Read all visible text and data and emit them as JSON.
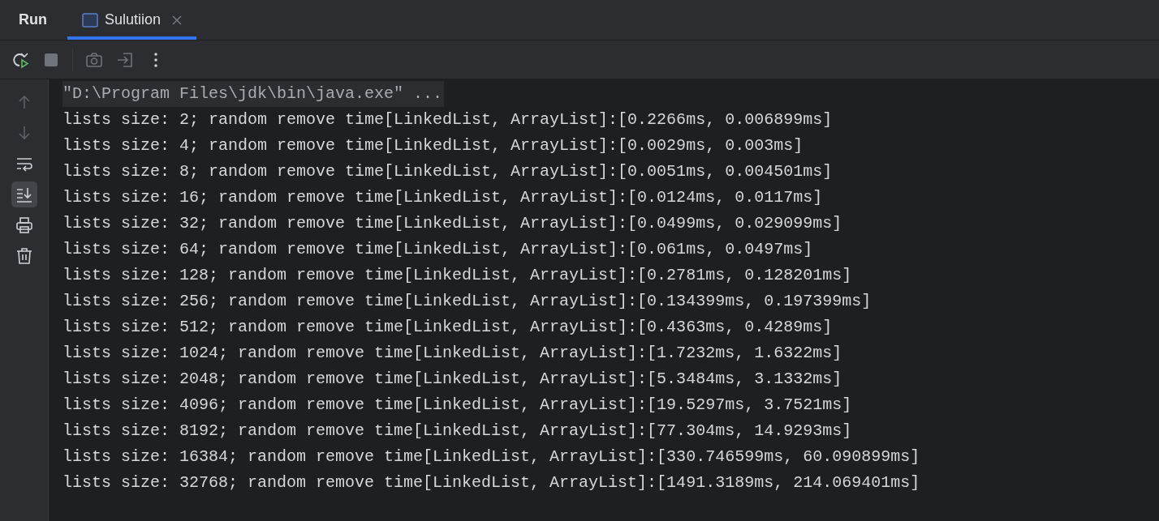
{
  "header": {
    "title": "Run"
  },
  "tabs": [
    {
      "label": "Sulutiion",
      "selected": true,
      "closable": true
    }
  ],
  "toolbar": [
    {
      "kind": "rerun"
    },
    {
      "kind": "stop"
    },
    {
      "kind": "separator"
    },
    {
      "kind": "camera"
    },
    {
      "kind": "exit"
    },
    {
      "kind": "more"
    }
  ],
  "side_tools": [
    {
      "kind": "up",
      "selected": false
    },
    {
      "kind": "down",
      "selected": false
    },
    {
      "kind": "wrap",
      "selected": false
    },
    {
      "kind": "scroll-end",
      "selected": true
    },
    {
      "kind": "print",
      "selected": false
    },
    {
      "kind": "trash",
      "selected": false
    }
  ],
  "console": {
    "command": "\"D:\\Program Files\\jdk\\bin\\java.exe\" ...",
    "lines": [
      "lists size: 2; random remove time[LinkedList, ArrayList]:[0.2266ms, 0.006899ms]",
      "lists size: 4; random remove time[LinkedList, ArrayList]:[0.0029ms, 0.003ms]",
      "lists size: 8; random remove time[LinkedList, ArrayList]:[0.0051ms, 0.004501ms]",
      "lists size: 16; random remove time[LinkedList, ArrayList]:[0.0124ms, 0.0117ms]",
      "lists size: 32; random remove time[LinkedList, ArrayList]:[0.0499ms, 0.029099ms]",
      "lists size: 64; random remove time[LinkedList, ArrayList]:[0.061ms, 0.0497ms]",
      "lists size: 128; random remove time[LinkedList, ArrayList]:[0.2781ms, 0.128201ms]",
      "lists size: 256; random remove time[LinkedList, ArrayList]:[0.134399ms, 0.197399ms]",
      "lists size: 512; random remove time[LinkedList, ArrayList]:[0.4363ms, 0.4289ms]",
      "lists size: 1024; random remove time[LinkedList, ArrayList]:[1.7232ms, 1.6322ms]",
      "lists size: 2048; random remove time[LinkedList, ArrayList]:[5.3484ms, 3.1332ms]",
      "lists size: 4096; random remove time[LinkedList, ArrayList]:[19.5297ms, 3.7521ms]",
      "lists size: 8192; random remove time[LinkedList, ArrayList]:[77.304ms, 14.9293ms]",
      "lists size: 16384; random remove time[LinkedList, ArrayList]:[330.746599ms, 60.090899ms]",
      "lists size: 32768; random remove time[LinkedList, ArrayList]:[1491.3189ms, 214.069401ms]"
    ]
  }
}
